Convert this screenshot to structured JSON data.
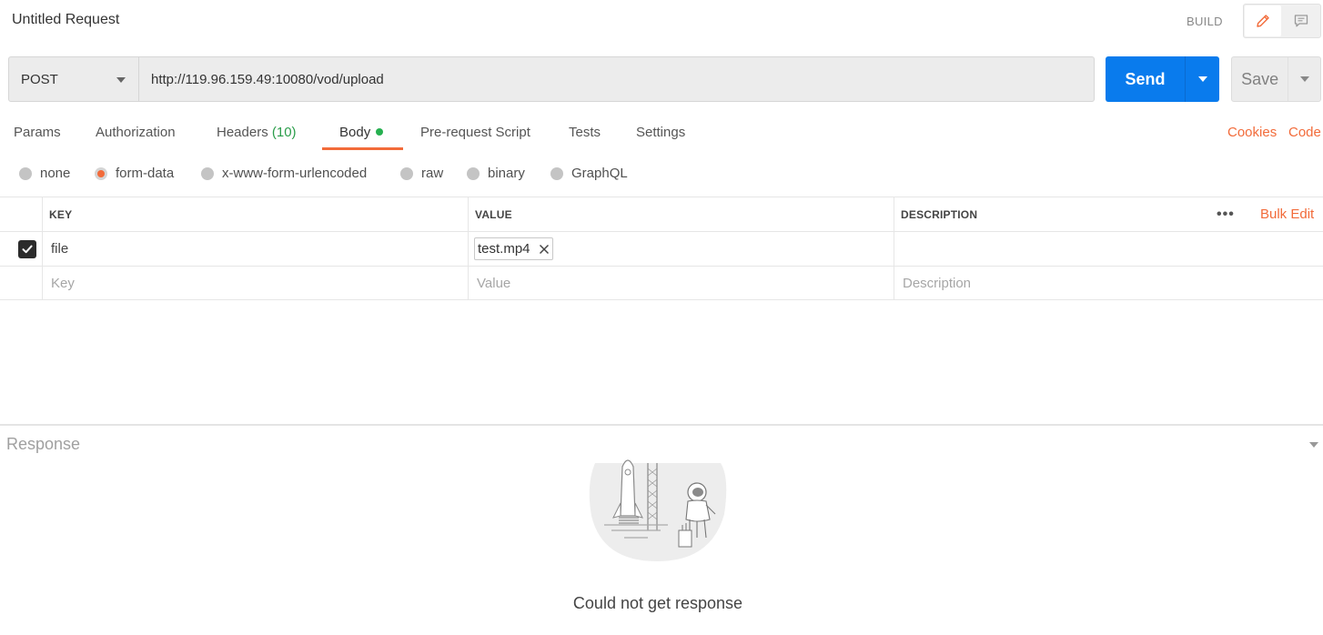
{
  "header": {
    "title": "Untitled Request",
    "build_label": "BUILD",
    "modes": [
      {
        "icon": "pencil-icon",
        "active": true
      },
      {
        "icon": "comment-icon",
        "active": false
      }
    ]
  },
  "request": {
    "method": "POST",
    "url": "http://119.96.159.49:10080/vod/upload",
    "send_label": "Send",
    "save_label": "Save"
  },
  "tabs": {
    "items": [
      {
        "label": "Params"
      },
      {
        "label": "Authorization"
      },
      {
        "label": "Headers",
        "count": "(10)"
      },
      {
        "label": "Body",
        "active": true
      },
      {
        "label": "Pre-request Script"
      },
      {
        "label": "Tests"
      },
      {
        "label": "Settings"
      }
    ],
    "cookies_label": "Cookies",
    "code_label": "Code"
  },
  "body_types": {
    "selected": "form-data",
    "options": [
      "none",
      "form-data",
      "x-www-form-urlencoded",
      "raw",
      "binary",
      "GraphQL"
    ]
  },
  "table": {
    "headers": {
      "key": "KEY",
      "value": "VALUE",
      "description": "DESCRIPTION"
    },
    "more_label": "•••",
    "bulk_edit_label": "Bulk Edit",
    "rows": [
      {
        "checked": true,
        "key": "file",
        "value_file": "test.mp4",
        "description": ""
      }
    ],
    "placeholders": {
      "key": "Key",
      "value": "Value",
      "description": "Description"
    }
  },
  "response": {
    "title": "Response",
    "message": "Could not get response"
  },
  "colors": {
    "accent_orange": "#f26b3a",
    "send_blue": "#097bed",
    "count_green": "#2a9d4a"
  }
}
